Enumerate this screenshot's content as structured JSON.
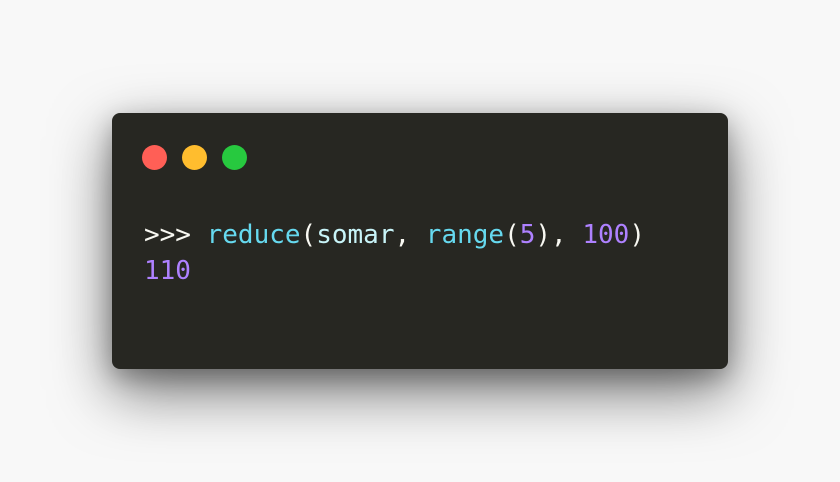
{
  "window": {
    "controls": [
      {
        "name": "close",
        "color": "#ff5f56"
      },
      {
        "name": "minimize",
        "color": "#ffbd2e"
      },
      {
        "name": "maximize",
        "color": "#27c93f"
      }
    ]
  },
  "code": {
    "line1": {
      "prompt": ">>>",
      "func_reduce": "reduce",
      "paren_open": "(",
      "arg_somar": "somar",
      "comma1": ",",
      "func_range": "range",
      "range_paren_open": "(",
      "num_5": "5",
      "range_paren_close": ")",
      "comma2": ",",
      "num_100": "100",
      "paren_close": ")"
    },
    "line2": {
      "output": "110"
    }
  }
}
